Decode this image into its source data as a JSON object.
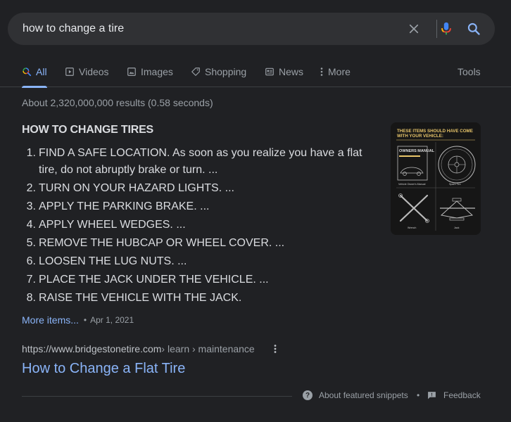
{
  "search": {
    "query": "how to change a tire"
  },
  "tabs": [
    {
      "label": "All",
      "icon": "search-icon",
      "active": true
    },
    {
      "label": "Videos",
      "icon": "video-icon"
    },
    {
      "label": "Images",
      "icon": "image-icon"
    },
    {
      "label": "Shopping",
      "icon": "tag-icon"
    },
    {
      "label": "News",
      "icon": "news-icon"
    },
    {
      "label": "More",
      "icon": "more-vert-icon"
    }
  ],
  "tools_label": "Tools",
  "result_stats": "About 2,320,000,000 results (0.58 seconds)",
  "snippet": {
    "title": "HOW TO CHANGE TIRES",
    "steps": [
      {
        "num": "1.",
        "text": "FIND A SAFE LOCATION. As soon as you realize you have a flat tire, do not abruptly brake or turn. ..."
      },
      {
        "num": "2.",
        "text": "TURN ON YOUR HAZARD LIGHTS. ..."
      },
      {
        "num": "3.",
        "text": "APPLY THE PARKING BRAKE. ..."
      },
      {
        "num": "4.",
        "text": "APPLY WHEEL WEDGES. ..."
      },
      {
        "num": "5.",
        "text": "REMOVE THE HUBCAP OR WHEEL COVER. ..."
      },
      {
        "num": "6.",
        "text": "LOOSEN THE LUG NUTS. ..."
      },
      {
        "num": "7.",
        "text": "PLACE THE JACK UNDER THE VEHICLE. ..."
      },
      {
        "num": "8.",
        "text": "RAISE THE VEHICLE WITH THE JACK."
      }
    ],
    "more_items": "More items...",
    "date": "Apr 1, 2021",
    "thumbnail": {
      "heading": "THESE ITEMS SHOULD HAVE COME WITH YOUR VEHICLE:",
      "manual_title": "OWNERS MANUAL",
      "label_manual": "Vehicle Owner's Manual",
      "label_tire": "Spare Tire",
      "label_wrench": "Wrench",
      "label_jack": "Jack"
    }
  },
  "result": {
    "site": "https://www.bridgestonetire.com",
    "crumbs": " › learn › maintenance",
    "title": "How to Change a Flat Tire"
  },
  "footer": {
    "about": "About featured snippets",
    "dot": "•",
    "feedback": "Feedback"
  },
  "colors": {
    "background": "#202124",
    "search_bg": "#303134",
    "link": "#8ab4f8",
    "muted": "#9aa0a6",
    "thumb_accent": "#e8c56a"
  }
}
